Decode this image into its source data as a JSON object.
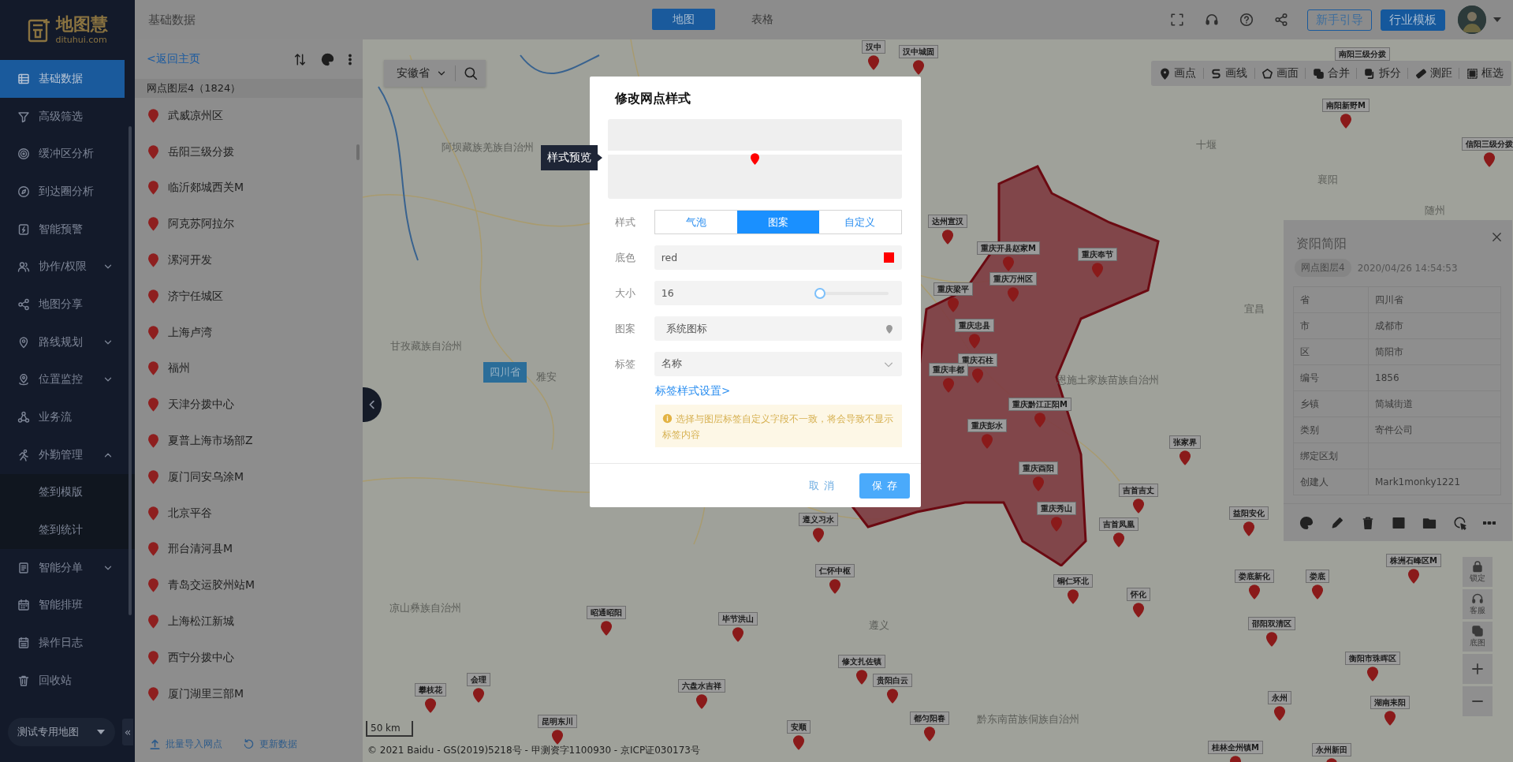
{
  "app": {
    "logo": "地图慧",
    "logo_sub": "dituhui.com"
  },
  "sidebar": {
    "items": [
      {
        "label": "基础数据",
        "selected": true
      },
      {
        "label": "高级筛选",
        "selected": false
      },
      {
        "label": "缓冲区分析",
        "selected": false
      },
      {
        "label": "到达圈分析",
        "selected": false
      },
      {
        "label": "智能预警",
        "selected": false
      },
      {
        "label": "协作/权限",
        "selected": false,
        "expanded": false
      },
      {
        "label": "地图分享",
        "selected": false
      },
      {
        "label": "路线规划",
        "selected": false,
        "expanded": false
      },
      {
        "label": "位置监控",
        "selected": false,
        "expanded": false
      },
      {
        "label": "业务流",
        "selected": false
      },
      {
        "label": "外勤管理",
        "selected": false,
        "expanded": true,
        "children": [
          {
            "label": "签到模版",
            "selected": false
          },
          {
            "label": "签到统计",
            "selected": false
          }
        ]
      },
      {
        "label": "智能分单",
        "selected": false,
        "expanded": false
      },
      {
        "label": "智能排班",
        "selected": false
      },
      {
        "label": "操作日志",
        "selected": false
      },
      {
        "label": "回收站",
        "selected": false
      }
    ],
    "map_selector": "测试专用地图",
    "collapse": "«"
  },
  "top_bar": {
    "title": "基础数据",
    "tabs": [
      {
        "label": "地图",
        "selected": true
      },
      {
        "label": "表格",
        "selected": false
      }
    ],
    "buttons": [
      {
        "label": "新手引导",
        "kind": "outline"
      },
      {
        "label": "行业模板",
        "kind": "primary"
      }
    ]
  },
  "list_panel": {
    "back": "<返回主页",
    "layer": "网点图层4（1824）",
    "items": [
      "武威凉州区",
      "岳阳三级分拨",
      "临沂郯城西关M",
      "阿克苏阿拉尔",
      "漯河开发",
      "济宁任城区",
      "上海卢湾",
      "福州",
      "天津分拨中心",
      "夏普上海市场部Z",
      "厦门同安乌涂M",
      "北京平谷",
      "邢台清河县M",
      "青岛交运胶州站M",
      "上海松江新城",
      "西宁分拨中心",
      "厦门湖里三部M"
    ],
    "footer": [
      "批量导入网点",
      "更新数据"
    ]
  },
  "map": {
    "region_select": "安徽省",
    "tools": [
      "画点",
      "画线",
      "画面",
      "合并",
      "拆分",
      "测距",
      "框选"
    ],
    "place_labels": [
      "阿坝藏族羌族自治州",
      "甘孜藏族自治州",
      "雅安",
      "凉山彝族自治州",
      "恩施土家族苗族自治州",
      "黔东南苗族侗族自治州",
      "十堰",
      "襄阳",
      "宜昌",
      "随州",
      "遵义"
    ],
    "province_badge": "四川省",
    "pin_labels": [
      "汉中",
      "汉中城固",
      "南阳三级分拨",
      "南阳新野M",
      "信阳三级分拨",
      "达州宣汉",
      "重庆开县赵家M",
      "重庆奉节",
      "重庆万州区",
      "重庆梁平",
      "重庆忠县",
      "重庆石柱",
      "重庆丰都",
      "重庆黔江正阳M",
      "重庆彭水",
      "张家界",
      "重庆酉阳",
      "吉首吉丈",
      "重庆秀山",
      "益阳安化",
      "遵义习水",
      "吉首凤凰",
      "株洲石峰区M",
      "仁怀中枢",
      "娄底新化",
      "娄底",
      "铜仁环北",
      "怀化",
      "昭通昭阳",
      "毕节洪山",
      "邵阳双清区",
      "修文扎佐镇",
      "衡阳市珠晖区",
      "贵阳白云",
      "会理",
      "六盘水吉祥",
      "攀枝花",
      "湖南耒阳",
      "永州",
      "都匀阳春",
      "安顺",
      "昆明东川",
      "桂林全州镇M",
      "永州新田"
    ],
    "controls": [
      "锁定",
      "客服",
      "底图"
    ],
    "scale": "50 km",
    "copyright": "© 2021 Baidu - GS(2019)5218号 - 甲测资字1100930 - 京ICP证030173号"
  },
  "info_panel": {
    "title": "资阳简阳",
    "layer_tag": "网点图层4",
    "time": "2020/04/26 14:54:53",
    "fields": [
      {
        "name": "省",
        "value": "四川省"
      },
      {
        "name": "市",
        "value": "成都市"
      },
      {
        "name": "区",
        "value": "简阳市"
      },
      {
        "name": "编号",
        "value": "1856"
      },
      {
        "name": "乡镇",
        "value": "简城街道"
      },
      {
        "name": "类别",
        "value": "寄件公司"
      },
      {
        "name": "绑定区划"
      },
      {
        "name": "创建人",
        "value": "Mark1monky1221"
      }
    ]
  },
  "dialog": {
    "title": "修改网点样式",
    "preview_tooltip": "样式预览",
    "style_label": "样式",
    "style_options": [
      {
        "label": "气泡",
        "selected": false
      },
      {
        "label": "图案",
        "selected": true
      },
      {
        "label": "自定义",
        "selected": false
      }
    ],
    "fields": [
      {
        "kind": "color",
        "label": "底色",
        "value": "red",
        "color": "#ff0000"
      },
      {
        "kind": "slider",
        "label": "大小",
        "value": "16",
        "level": 0.03
      },
      {
        "kind": "icon",
        "label": "图案",
        "value": "系统图标"
      },
      {
        "kind": "select",
        "label": "标签",
        "value": "名称"
      }
    ],
    "link": "标签样式设置>",
    "warning": "选择与图层标签自定义字段不一致，将会导致不显示标签内容",
    "buttons": [
      {
        "label": "取消",
        "kind": "text"
      },
      {
        "label": "保存",
        "kind": "primary"
      }
    ]
  }
}
